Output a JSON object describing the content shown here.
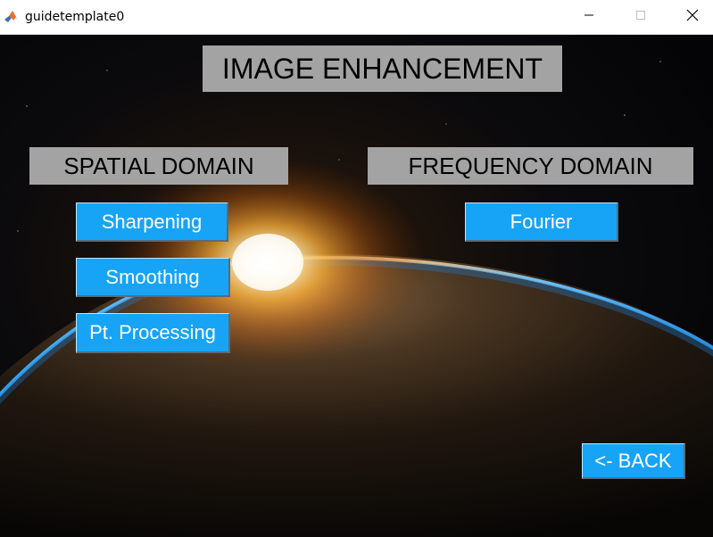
{
  "window": {
    "title": "guidetemplate0",
    "app_icon": "matlab-icon",
    "controls": {
      "minimize_icon": "minimize-icon",
      "maximize_icon": "maximize-icon",
      "close_icon": "close-icon"
    }
  },
  "figure": {
    "title": "IMAGE ENHANCEMENT",
    "background": "earth-sunrise-image",
    "spatial": {
      "heading": "SPATIAL DOMAIN",
      "buttons": [
        "Sharpening",
        "Smoothing",
        "Pt. Processing"
      ]
    },
    "frequency": {
      "heading": "FREQUENCY DOMAIN",
      "buttons": [
        "Fourier"
      ]
    },
    "back_label": "<- BACK"
  },
  "colors": {
    "label_bg": "#a3a3a3",
    "button_bg": "#17a4f7",
    "button_text": "#ffffff"
  }
}
